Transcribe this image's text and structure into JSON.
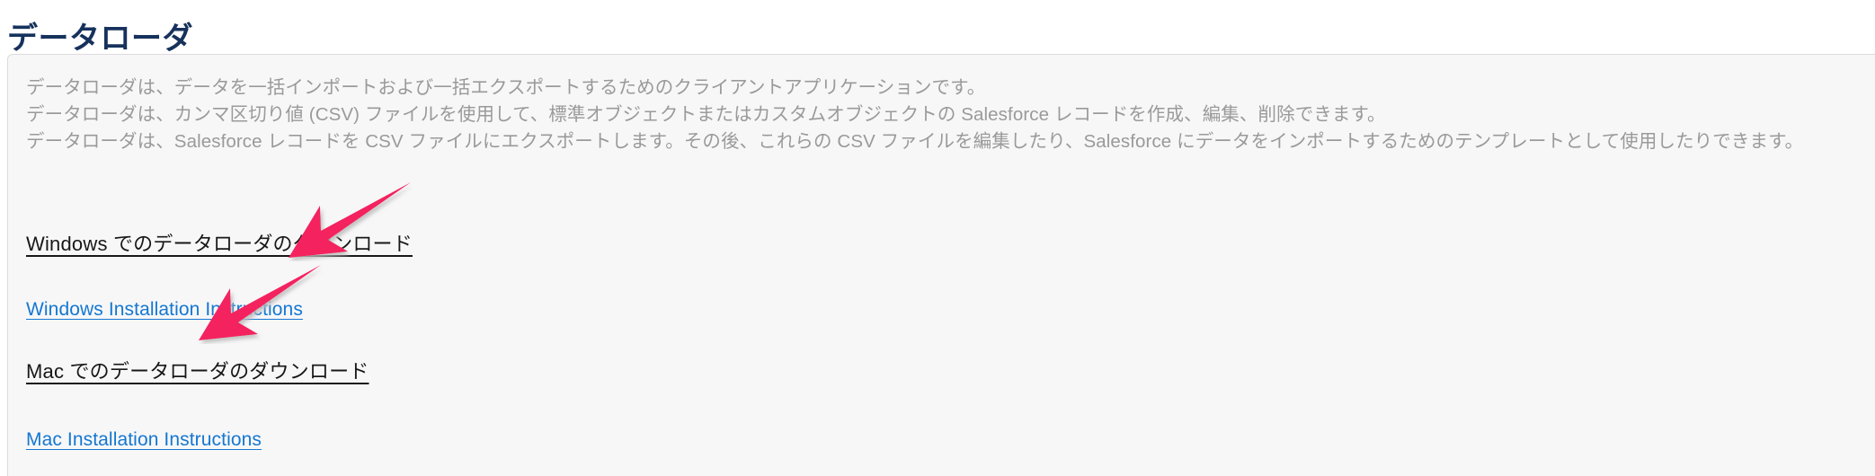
{
  "page": {
    "title": "データローダ",
    "title_color": "#16325c",
    "background_color": "#ffffff",
    "card_background_color": "#f7f7f8",
    "card_border_color": "#dddbda"
  },
  "intro": {
    "body_color": "#9a9a9a",
    "lines": [
      "データローダは、データを一括インポートおよび一括エクスポートするためのクライアントアプリケーションです。",
      "データローダは、カンマ区切り値 (CSV) ファイルを使用して、標準オブジェクトまたはカスタムオブジェクトの Salesforce レコードを作成、編集、削除できます。",
      "データローダは、Salesforce レコードを CSV ファイルにエクスポートします。その後、これらの CSV ファイルを編集したり、Salesforce にデータをインポートするためのテンプレートとして使用したりできます。"
    ]
  },
  "links": {
    "download_link_color": "#181818",
    "instruction_link_color": "#1577d1",
    "windows_download": "Windows でのデータローダのダウンロード",
    "windows_instructions": "Windows Installation Instructions",
    "mac_download": "Mac でのデータローダのダウンロード",
    "mac_instructions": "Mac Installation Instructions"
  },
  "annotations": {
    "arrow_color": "#f4205e",
    "arrow_shadow_color": "#d0d0d0",
    "items": [
      {
        "name": "arrow-pointing-to-windows-download",
        "target": "Windows でのデータローダのダウンロード"
      },
      {
        "name": "arrow-pointing-to-mac-download",
        "target": "Mac でのデータローダのダウンロード"
      }
    ]
  }
}
